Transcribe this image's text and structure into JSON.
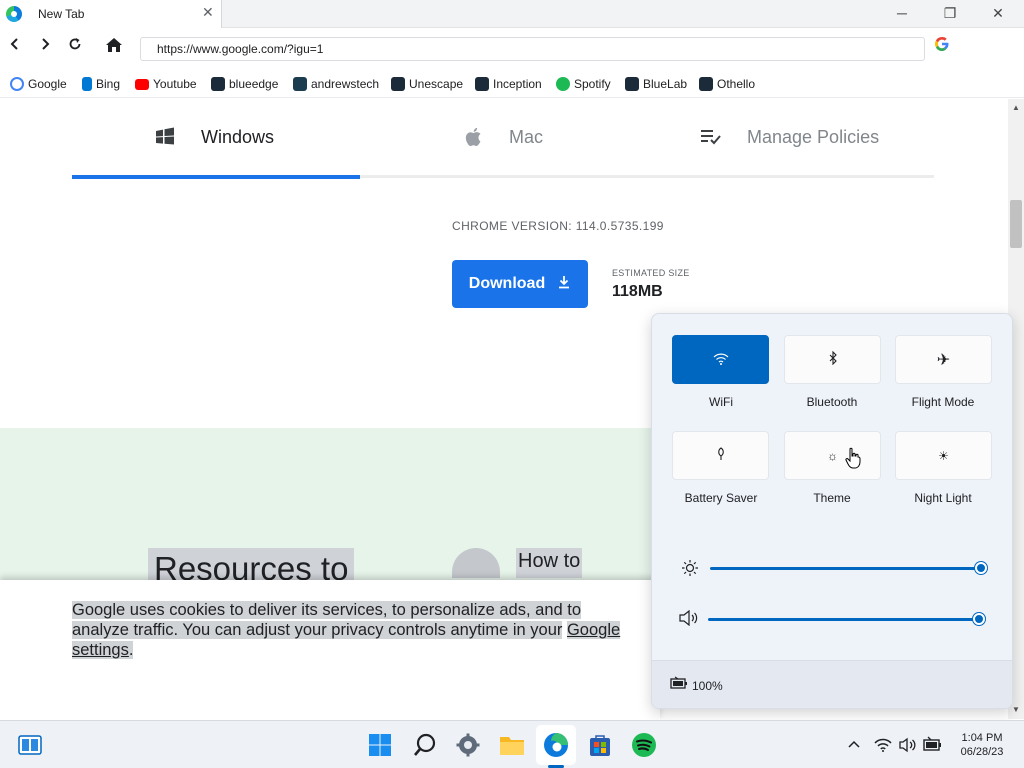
{
  "tab": {
    "title": "New Tab",
    "close": "✕"
  },
  "window": {
    "minimize": "─",
    "restore": "❐",
    "close": "✕"
  },
  "address": {
    "url": "https://www.google.com/?igu=1",
    "g_icon": "G"
  },
  "bookmarks": [
    {
      "label": "Google",
      "icon": "google-icon",
      "color": "#4285f4"
    },
    {
      "label": "Bing",
      "icon": "bing-icon",
      "color": "#0078d4"
    },
    {
      "label": "Youtube",
      "icon": "youtube-icon",
      "color": "#ff0000"
    },
    {
      "label": "blueedge",
      "icon": "react-icon",
      "color": "#1b2b3a"
    },
    {
      "label": "andrewstech",
      "icon": "andrewstech-icon",
      "color": "#1b3d4f"
    },
    {
      "label": "Unescape",
      "icon": "react-icon",
      "color": "#1b2b3a"
    },
    {
      "label": "Inception",
      "icon": "react-icon",
      "color": "#1b2b3a"
    },
    {
      "label": "Spotify",
      "icon": "spotify-icon",
      "color": "#1db954"
    },
    {
      "label": "BlueLab",
      "icon": "react-icon",
      "color": "#1b2b3a"
    },
    {
      "label": "Othello",
      "icon": "react-icon",
      "color": "#1b2b3a"
    }
  ],
  "page": {
    "tabs": [
      {
        "label": "Windows",
        "icon": "windows-icon",
        "active": true
      },
      {
        "label": "Mac",
        "icon": "apple-icon",
        "active": false
      },
      {
        "label": "Manage Policies",
        "icon": "policy-list-icon",
        "active": false
      }
    ],
    "version": "CHROME VERSION: 114.0.5735.199",
    "download_label": "Download",
    "estimated_label": "ESTIMATED SIZE",
    "estimated_value": "118MB",
    "resources_heading": "Resources to",
    "howto_heading": "How to",
    "cookie": {
      "text_1": "Google uses cookies to deliver its services, to personalize ads, and to analyze traffic. You can adjust your privacy controls anytime in your",
      "link": "Google settings",
      "text_2": "."
    }
  },
  "quick_settings": {
    "tiles": [
      {
        "label": "WiFi",
        "icon": "wifi-icon",
        "on": true
      },
      {
        "label": "Bluetooth",
        "icon": "bluetooth-icon",
        "on": false
      },
      {
        "label": "Flight Mode",
        "icon": "airplane-icon",
        "on": false
      },
      {
        "label": "Battery Saver",
        "icon": "battery-saver-icon",
        "on": false
      },
      {
        "label": "Theme",
        "icon": "theme-icon",
        "on": false
      },
      {
        "label": "Night Light",
        "icon": "night-light-icon",
        "on": false
      }
    ],
    "brightness": 1.0,
    "volume": 1.0,
    "battery": "100%",
    "accent": "#0067c0"
  },
  "taskbar": {
    "time": "1:04 PM",
    "date": "06/28/23",
    "apps": [
      "widgets-icon",
      "windows-start-icon",
      "search-icon",
      "settings-icon",
      "file-explorer-icon",
      "edge-icon",
      "store-icon",
      "spotify-icon"
    ]
  }
}
